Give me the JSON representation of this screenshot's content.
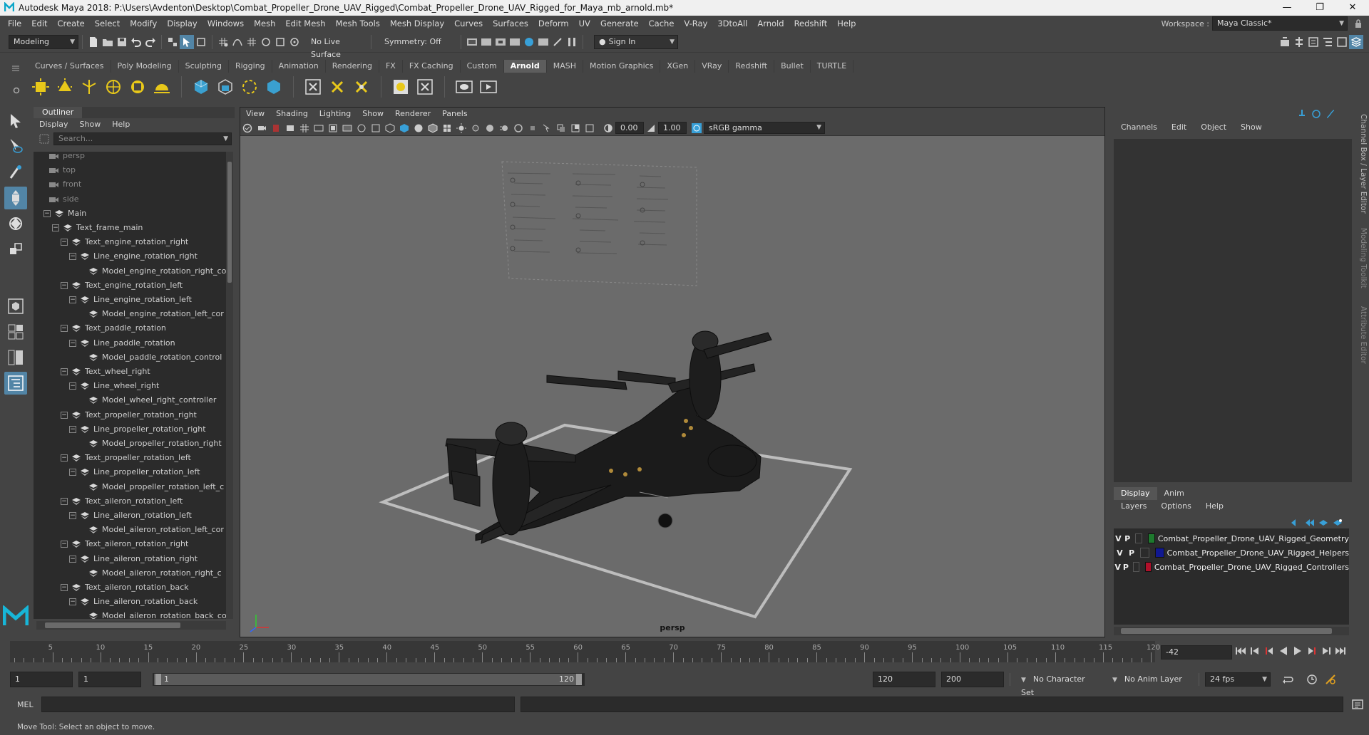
{
  "window": {
    "title": "Autodesk Maya 2018: P:\\Users\\Avdenton\\Desktop\\Combat_Propeller_Drone_UAV_Rigged\\Combat_Propeller_Drone_UAV_Rigged_for_Maya_mb_arnold.mb*",
    "minimize": "—",
    "maximize": "❐",
    "close": "✕"
  },
  "menubar": {
    "items": [
      "File",
      "Edit",
      "Create",
      "Select",
      "Modify",
      "Display",
      "Windows",
      "Mesh",
      "Edit Mesh",
      "Mesh Tools",
      "Mesh Display",
      "Curves",
      "Surfaces",
      "Deform",
      "UV",
      "Generate",
      "Cache",
      "V-Ray",
      "3DtoAll",
      "Arnold",
      "Redshift",
      "Help"
    ],
    "workspace_label": "Workspace :",
    "workspace_value": "Maya Classic*"
  },
  "statusline": {
    "mode": "Modeling",
    "live_surface": "No Live Surface",
    "symmetry": "Symmetry: Off",
    "sign_in": "Sign In"
  },
  "shelf": {
    "tabs": [
      "Curves / Surfaces",
      "Poly Modeling",
      "Sculpting",
      "Rigging",
      "Animation",
      "Rendering",
      "FX",
      "FX Caching",
      "Custom",
      "Arnold",
      "MASH",
      "Motion Graphics",
      "XGen",
      "VRay",
      "Redshift",
      "Bullet",
      "TURTLE"
    ],
    "active_tab": "Arnold"
  },
  "outliner": {
    "title": "Outliner",
    "menu": [
      "Display",
      "Show",
      "Help"
    ],
    "search_placeholder": "Search...",
    "nodes": [
      {
        "label": "persp",
        "depth": 0,
        "type": "camera",
        "exp": ""
      },
      {
        "label": "top",
        "depth": 0,
        "type": "camera",
        "exp": ""
      },
      {
        "label": "front",
        "depth": 0,
        "type": "camera",
        "exp": ""
      },
      {
        "label": "side",
        "depth": 0,
        "type": "camera",
        "exp": ""
      },
      {
        "label": "Main",
        "depth": 0,
        "type": "group",
        "exp": "−"
      },
      {
        "label": "Text_frame_main",
        "depth": 1,
        "type": "group",
        "exp": "−"
      },
      {
        "label": "Text_engine_rotation_right",
        "depth": 2,
        "type": "group",
        "exp": "−"
      },
      {
        "label": "Line_engine_rotation_right",
        "depth": 3,
        "type": "group",
        "exp": "−"
      },
      {
        "label": "Model_engine_rotation_right_co",
        "depth": 4,
        "type": "group",
        "exp": ""
      },
      {
        "label": "Text_engine_rotation_left",
        "depth": 2,
        "type": "group",
        "exp": "−"
      },
      {
        "label": "Line_engine_rotation_left",
        "depth": 3,
        "type": "group",
        "exp": "−"
      },
      {
        "label": "Model_engine_rotation_left_cor",
        "depth": 4,
        "type": "group",
        "exp": ""
      },
      {
        "label": "Text_paddle_rotation",
        "depth": 2,
        "type": "group",
        "exp": "−"
      },
      {
        "label": "Line_paddle_rotation",
        "depth": 3,
        "type": "group",
        "exp": "−"
      },
      {
        "label": "Model_paddle_rotation_control",
        "depth": 4,
        "type": "group",
        "exp": ""
      },
      {
        "label": "Text_wheel_right",
        "depth": 2,
        "type": "group",
        "exp": "−"
      },
      {
        "label": "Line_wheel_right",
        "depth": 3,
        "type": "group",
        "exp": "−"
      },
      {
        "label": "Model_wheel_right_controller",
        "depth": 4,
        "type": "group",
        "exp": ""
      },
      {
        "label": "Text_propeller_rotation_right",
        "depth": 2,
        "type": "group",
        "exp": "−"
      },
      {
        "label": "Line_propeller_rotation_right",
        "depth": 3,
        "type": "group",
        "exp": "−"
      },
      {
        "label": "Model_propeller_rotation_right",
        "depth": 4,
        "type": "group",
        "exp": ""
      },
      {
        "label": "Text_propeller_rotation_left",
        "depth": 2,
        "type": "group",
        "exp": "−"
      },
      {
        "label": "Line_propeller_rotation_left",
        "depth": 3,
        "type": "group",
        "exp": "−"
      },
      {
        "label": "Model_propeller_rotation_left_c",
        "depth": 4,
        "type": "group",
        "exp": ""
      },
      {
        "label": "Text_aileron_rotation_left",
        "depth": 2,
        "type": "group",
        "exp": "−"
      },
      {
        "label": "Line_aileron_rotation_left",
        "depth": 3,
        "type": "group",
        "exp": "−"
      },
      {
        "label": "Model_aileron_rotation_left_cor",
        "depth": 4,
        "type": "group",
        "exp": ""
      },
      {
        "label": "Text_aileron_rotation_right",
        "depth": 2,
        "type": "group",
        "exp": "−"
      },
      {
        "label": "Line_aileron_rotation_right",
        "depth": 3,
        "type": "group",
        "exp": "−"
      },
      {
        "label": "Model_aileron_rotation_right_c",
        "depth": 4,
        "type": "group",
        "exp": ""
      },
      {
        "label": "Text_aileron_rotation_back",
        "depth": 2,
        "type": "group",
        "exp": "−"
      },
      {
        "label": "Line_aileron_rotation_back",
        "depth": 3,
        "type": "group",
        "exp": "−"
      },
      {
        "label": "Model_aileron_rotation_back_co",
        "depth": 4,
        "type": "group",
        "exp": ""
      }
    ]
  },
  "viewport": {
    "menu": [
      "View",
      "Shading",
      "Lighting",
      "Show",
      "Renderer",
      "Panels"
    ],
    "exposure": "0.00",
    "gamma": "1.00",
    "colorspace": "sRGB gamma",
    "camera_label": "persp"
  },
  "channelbox": {
    "menu": [
      "Channels",
      "Edit",
      "Object",
      "Show"
    ],
    "layer_tabs": [
      "Display",
      "Anim"
    ],
    "layer_menu": [
      "Layers",
      "Options",
      "Help"
    ],
    "layers": [
      {
        "v": "V",
        "p": "P",
        "name": "Combat_Propeller_Drone_UAV_Rigged_Geometry",
        "color": "#1e7a2e"
      },
      {
        "v": "V",
        "p": "P",
        "name": "Combat_Propeller_Drone_UAV_Rigged_Helpers",
        "color": "#101890"
      },
      {
        "v": "V",
        "p": "P",
        "name": "Combat_Propeller_Drone_UAV_Rigged_Controllers",
        "color": "#b0102a"
      }
    ],
    "side_tabs": [
      "Channel Box / Layer Editor",
      "Modeling Toolkit",
      "Attribute Editor"
    ]
  },
  "timeline": {
    "ticks": [
      "5",
      "10",
      "15",
      "20",
      "25",
      "30",
      "35",
      "40",
      "45",
      "50",
      "55",
      "60",
      "65",
      "70",
      "75",
      "80",
      "85",
      "90",
      "95",
      "100",
      "105",
      "110",
      "115",
      "120"
    ],
    "current_frame": "-42"
  },
  "range": {
    "start": "1",
    "anim_start": "1",
    "range_start": "1",
    "range_end": "120",
    "end": "120",
    "anim_end": "200",
    "character_set": "No Character Set",
    "anim_layer": "No Anim Layer",
    "fps": "24 fps"
  },
  "command": {
    "lang": "MEL",
    "help_text": "Move Tool: Select an object to move."
  }
}
